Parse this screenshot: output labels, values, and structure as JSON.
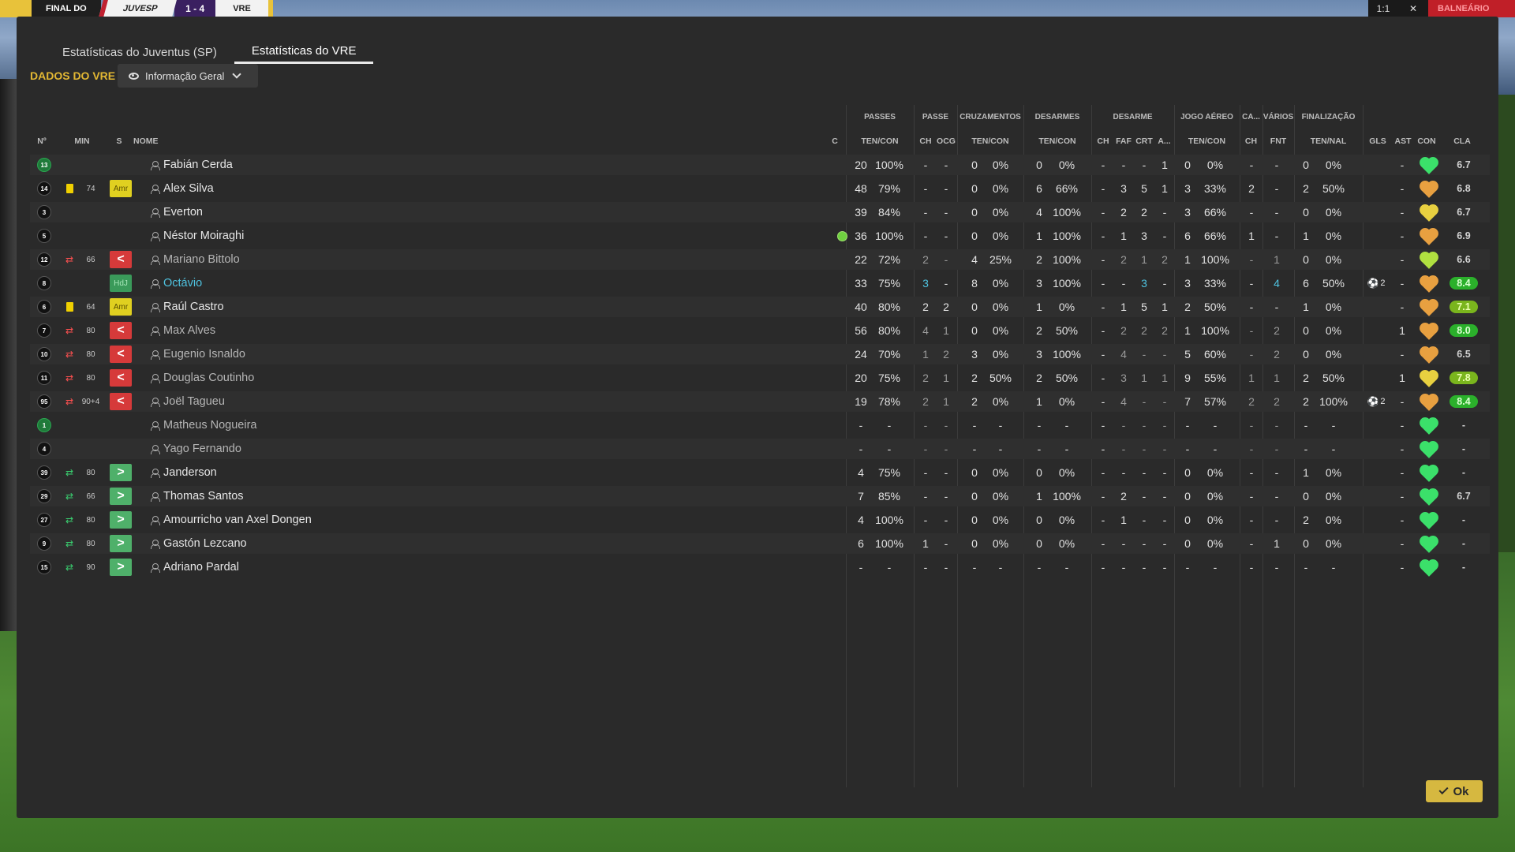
{
  "topbar": {
    "stage": "FINAL DO",
    "home": "JUVESP",
    "score": "1 - 4",
    "away": "VRE",
    "right_btn1": "1:1",
    "right_btn2": "✕",
    "right_label": "BALNEÁRIO"
  },
  "tabs": [
    {
      "label": "Estatísticas do Juventus (SP)"
    },
    {
      "label": "Estatísticas do VRE"
    }
  ],
  "section_title": "DADOS DO VRE",
  "view_select": "Informação Geral",
  "groups": {
    "passes": "PASSES",
    "passe": "PASSE",
    "cruz": "CRUZAMENTOS",
    "desarmes": "DESARMES",
    "desarme": "DESARME",
    "aereo": "JOGO AÉREO",
    "ca": "CA...",
    "varios": "VÁRIOS",
    "final": "FINALIZAÇÃO"
  },
  "headers": {
    "num": "Nº",
    "min": "MIN",
    "s": "S",
    "nome": "NOME",
    "c": "C",
    "passes_tc": "TEN/CON",
    "passe_ch": "CH",
    "passe_ocg": "OCG",
    "cruz_tc": "TEN/CON",
    "des_tc": "TEN/CON",
    "d_ch": "CH",
    "d_faf": "FAF",
    "d_crt": "CRT",
    "d_a": "A...",
    "aereo_tc": "TEN/CON",
    "ca_ch": "CH",
    "fnt": "FNT",
    "fin_tn": "TEN/NAL",
    "gls": "GLS",
    "ast": "AST",
    "con": "CON",
    "cla": "CLA"
  },
  "rows": [
    {
      "num": "13",
      "gk": true,
      "min": "",
      "card": "",
      "sub": "",
      "badge": "",
      "name": "Fabián Cerda",
      "style": "",
      "ball": false,
      "pt": "20",
      "pp": "100%",
      "pch": "-",
      "pocg": "-",
      "ct": "0",
      "cp": "0%",
      "dt": "0",
      "dp": "0%",
      "dch": "-",
      "dfaf": "-",
      "dcrt": "-",
      "da": "1",
      "at": "0",
      "ap": "0%",
      "cach": "-",
      "fnt": "-",
      "ft": "0",
      "fp": "0%",
      "gls": "",
      "ast": "-",
      "heart": "#3be06a",
      "cla": "6.7",
      "cla_style": ""
    },
    {
      "num": "14",
      "gk": false,
      "min": "74",
      "card": "y",
      "sub": "",
      "badge": "Amr",
      "name": "Alex Silva",
      "style": "",
      "ball": false,
      "pt": "48",
      "pp": "79%",
      "pch": "-",
      "pocg": "-",
      "ct": "0",
      "cp": "0%",
      "dt": "6",
      "dp": "66%",
      "dch": "-",
      "dfaf": "3",
      "dcrt": "5",
      "da": "1",
      "at": "3",
      "ap": "33%",
      "cach": "2",
      "fnt": "-",
      "ft": "2",
      "fp": "50%",
      "gls": "",
      "ast": "-",
      "heart": "#e8a040",
      "cla": "6.8",
      "cla_style": ""
    },
    {
      "num": "3",
      "gk": false,
      "min": "",
      "card": "",
      "sub": "",
      "badge": "",
      "name": "Everton",
      "style": "",
      "ball": false,
      "pt": "39",
      "pp": "84%",
      "pch": "-",
      "pocg": "-",
      "ct": "0",
      "cp": "0%",
      "dt": "4",
      "dp": "100%",
      "dch": "-",
      "dfaf": "2",
      "dcrt": "2",
      "da": "-",
      "at": "3",
      "ap": "66%",
      "cach": "-",
      "fnt": "-",
      "ft": "0",
      "fp": "0%",
      "gls": "",
      "ast": "-",
      "heart": "#e8d040",
      "cla": "6.7",
      "cla_style": ""
    },
    {
      "num": "5",
      "gk": false,
      "min": "",
      "card": "",
      "sub": "",
      "badge": "",
      "name": "Néstor Moiraghi",
      "style": "",
      "ball": true,
      "pt": "36",
      "pp": "100%",
      "pch": "-",
      "pocg": "-",
      "ct": "0",
      "cp": "0%",
      "dt": "1",
      "dp": "100%",
      "dch": "-",
      "dfaf": "1",
      "dcrt": "3",
      "da": "-",
      "at": "6",
      "ap": "66%",
      "cach": "1",
      "fnt": "-",
      "ft": "1",
      "fp": "0%",
      "gls": "",
      "ast": "-",
      "heart": "#e8a040",
      "cla": "6.9",
      "cla_style": ""
    },
    {
      "num": "12",
      "gk": false,
      "min": "66",
      "card": "",
      "sub": "out",
      "badge": "<",
      "name": "Mariano Bittolo",
      "style": "subbed",
      "ball": false,
      "pt": "22",
      "pp": "72%",
      "pch": "2",
      "pocg": "-",
      "ct": "4",
      "cp": "25%",
      "dt": "2",
      "dp": "100%",
      "dch": "-",
      "dfaf": "2",
      "dcrt": "1",
      "da": "2",
      "at": "1",
      "ap": "100%",
      "cach": "-",
      "fnt": "1",
      "ft": "0",
      "fp": "0%",
      "gls": "",
      "ast": "-",
      "heart": "#b0e040",
      "cla": "6.6",
      "cla_style": ""
    },
    {
      "num": "8",
      "gk": false,
      "min": "",
      "card": "",
      "sub": "",
      "badge": "HdJ",
      "name": "Octávio",
      "style": "hl",
      "ball": false,
      "pt": "33",
      "pp": "75%",
      "pch": "3",
      "pocg": "-",
      "ct": "8",
      "cp": "0%",
      "dt": "3",
      "dp": "100%",
      "dch": "-",
      "dfaf": "-",
      "dcrt": "3",
      "da": "-",
      "at": "3",
      "ap": "33%",
      "cach": "-",
      "fnt": "4",
      "ft": "6",
      "fp": "50%",
      "gls": "2",
      "ast": "-",
      "heart": "#e8a040",
      "cla": "8.4",
      "cla_style": "good"
    },
    {
      "num": "6",
      "gk": false,
      "min": "64",
      "card": "y",
      "sub": "",
      "badge": "Amr",
      "name": "Raúl Castro",
      "style": "",
      "ball": false,
      "pt": "40",
      "pp": "80%",
      "pch": "2",
      "pocg": "2",
      "ct": "0",
      "cp": "0%",
      "dt": "1",
      "dp": "0%",
      "dch": "-",
      "dfaf": "1",
      "dcrt": "5",
      "da": "1",
      "at": "2",
      "ap": "50%",
      "cach": "-",
      "fnt": "-",
      "ft": "1",
      "fp": "0%",
      "gls": "",
      "ast": "-",
      "heart": "#e8a040",
      "cla": "7.1",
      "cla_style": "mid"
    },
    {
      "num": "7",
      "gk": false,
      "min": "80",
      "card": "",
      "sub": "out",
      "badge": "<",
      "name": "Max Alves",
      "style": "subbed",
      "ball": false,
      "pt": "56",
      "pp": "80%",
      "pch": "4",
      "pocg": "1",
      "ct": "0",
      "cp": "0%",
      "dt": "2",
      "dp": "50%",
      "dch": "-",
      "dfaf": "2",
      "dcrt": "2",
      "da": "2",
      "at": "1",
      "ap": "100%",
      "cach": "-",
      "fnt": "2",
      "ft": "0",
      "fp": "0%",
      "gls": "",
      "ast": "1",
      "heart": "#e8a040",
      "cla": "8.0",
      "cla_style": "good"
    },
    {
      "num": "10",
      "gk": false,
      "min": "80",
      "card": "",
      "sub": "out",
      "badge": "<",
      "name": "Eugenio Isnaldo",
      "style": "subbed",
      "ball": false,
      "pt": "24",
      "pp": "70%",
      "pch": "1",
      "pocg": "2",
      "ct": "3",
      "cp": "0%",
      "dt": "3",
      "dp": "100%",
      "dch": "-",
      "dfaf": "4",
      "dcrt": "-",
      "da": "-",
      "at": "5",
      "ap": "60%",
      "cach": "-",
      "fnt": "2",
      "ft": "0",
      "fp": "0%",
      "gls": "",
      "ast": "-",
      "heart": "#e8a040",
      "cla": "6.5",
      "cla_style": ""
    },
    {
      "num": "11",
      "gk": false,
      "min": "80",
      "card": "",
      "sub": "out",
      "badge": "<",
      "name": "Douglas Coutinho",
      "style": "subbed",
      "ball": false,
      "pt": "20",
      "pp": "75%",
      "pch": "2",
      "pocg": "1",
      "ct": "2",
      "cp": "50%",
      "dt": "2",
      "dp": "50%",
      "dch": "-",
      "dfaf": "3",
      "dcrt": "1",
      "da": "1",
      "at": "9",
      "ap": "55%",
      "cach": "1",
      "fnt": "1",
      "ft": "2",
      "fp": "50%",
      "gls": "",
      "ast": "1",
      "heart": "#e8d040",
      "cla": "7.8",
      "cla_style": "mid"
    },
    {
      "num": "95",
      "gk": false,
      "min": "90+4",
      "card": "",
      "sub": "out",
      "badge": "<",
      "name": "Joël Tagueu",
      "style": "subbed",
      "ball": false,
      "pt": "19",
      "pp": "78%",
      "pch": "2",
      "pocg": "1",
      "ct": "2",
      "cp": "0%",
      "dt": "1",
      "dp": "0%",
      "dch": "-",
      "dfaf": "4",
      "dcrt": "-",
      "da": "-",
      "at": "7",
      "ap": "57%",
      "cach": "2",
      "fnt": "2",
      "ft": "2",
      "fp": "100%",
      "gls": "2",
      "ast": "-",
      "heart": "#e8a040",
      "cla": "8.4",
      "cla_style": "good"
    },
    {
      "num": "1",
      "gk": true,
      "min": "",
      "card": "",
      "sub": "",
      "badge": "",
      "name": "Matheus Nogueira",
      "style": "subbed",
      "ball": false,
      "pt": "-",
      "pp": "-",
      "pch": "-",
      "pocg": "-",
      "ct": "-",
      "cp": "-",
      "dt": "-",
      "dp": "-",
      "dch": "-",
      "dfaf": "-",
      "dcrt": "-",
      "da": "-",
      "at": "-",
      "ap": "-",
      "cach": "-",
      "fnt": "-",
      "ft": "-",
      "fp": "-",
      "gls": "",
      "ast": "-",
      "heart": "#3be06a",
      "cla": "-",
      "cla_style": ""
    },
    {
      "num": "4",
      "gk": false,
      "min": "",
      "card": "",
      "sub": "",
      "badge": "",
      "name": "Yago Fernando",
      "style": "subbed",
      "ball": false,
      "pt": "-",
      "pp": "-",
      "pch": "-",
      "pocg": "-",
      "ct": "-",
      "cp": "-",
      "dt": "-",
      "dp": "-",
      "dch": "-",
      "dfaf": "-",
      "dcrt": "-",
      "da": "-",
      "at": "-",
      "ap": "-",
      "cach": "-",
      "fnt": "-",
      "ft": "-",
      "fp": "-",
      "gls": "",
      "ast": "-",
      "heart": "#3be06a",
      "cla": "-",
      "cla_style": ""
    },
    {
      "num": "39",
      "gk": false,
      "min": "80",
      "card": "",
      "sub": "in",
      "badge": ">",
      "name": "Janderson",
      "style": "",
      "ball": false,
      "pt": "4",
      "pp": "75%",
      "pch": "-",
      "pocg": "-",
      "ct": "0",
      "cp": "0%",
      "dt": "0",
      "dp": "0%",
      "dch": "-",
      "dfaf": "-",
      "dcrt": "-",
      "da": "-",
      "at": "0",
      "ap": "0%",
      "cach": "-",
      "fnt": "-",
      "ft": "1",
      "fp": "0%",
      "gls": "",
      "ast": "-",
      "heart": "#3be06a",
      "cla": "-",
      "cla_style": ""
    },
    {
      "num": "29",
      "gk": false,
      "min": "66",
      "card": "",
      "sub": "in",
      "badge": ">",
      "name": "Thomas Santos",
      "style": "",
      "ball": false,
      "pt": "7",
      "pp": "85%",
      "pch": "-",
      "pocg": "-",
      "ct": "0",
      "cp": "0%",
      "dt": "1",
      "dp": "100%",
      "dch": "-",
      "dfaf": "2",
      "dcrt": "-",
      "da": "-",
      "at": "0",
      "ap": "0%",
      "cach": "-",
      "fnt": "-",
      "ft": "0",
      "fp": "0%",
      "gls": "",
      "ast": "-",
      "heart": "#3be06a",
      "cla": "6.7",
      "cla_style": ""
    },
    {
      "num": "27",
      "gk": false,
      "min": "80",
      "card": "",
      "sub": "in",
      "badge": ">",
      "name": "Amourricho van Axel Dongen",
      "style": "",
      "ball": false,
      "pt": "4",
      "pp": "100%",
      "pch": "-",
      "pocg": "-",
      "ct": "0",
      "cp": "0%",
      "dt": "0",
      "dp": "0%",
      "dch": "-",
      "dfaf": "1",
      "dcrt": "-",
      "da": "-",
      "at": "0",
      "ap": "0%",
      "cach": "-",
      "fnt": "-",
      "ft": "2",
      "fp": "0%",
      "gls": "",
      "ast": "-",
      "heart": "#3be06a",
      "cla": "-",
      "cla_style": ""
    },
    {
      "num": "9",
      "gk": false,
      "min": "80",
      "card": "",
      "sub": "in",
      "badge": ">",
      "name": "Gastón Lezcano",
      "style": "",
      "ball": false,
      "pt": "6",
      "pp": "100%",
      "pch": "1",
      "pocg": "-",
      "ct": "0",
      "cp": "0%",
      "dt": "0",
      "dp": "0%",
      "dch": "-",
      "dfaf": "-",
      "dcrt": "-",
      "da": "-",
      "at": "0",
      "ap": "0%",
      "cach": "-",
      "fnt": "1",
      "ft": "0",
      "fp": "0%",
      "gls": "",
      "ast": "-",
      "heart": "#3be06a",
      "cla": "-",
      "cla_style": ""
    },
    {
      "num": "15",
      "gk": false,
      "min": "90",
      "card": "",
      "sub": "in",
      "badge": ">",
      "name": "Adriano Pardal",
      "style": "",
      "ball": false,
      "pt": "-",
      "pp": "-",
      "pch": "-",
      "pocg": "-",
      "ct": "-",
      "cp": "-",
      "dt": "-",
      "dp": "-",
      "dch": "-",
      "dfaf": "-",
      "dcrt": "-",
      "da": "-",
      "at": "-",
      "ap": "-",
      "cach": "-",
      "fnt": "-",
      "ft": "-",
      "fp": "-",
      "gls": "",
      "ast": "-",
      "heart": "#3be06a",
      "cla": "-",
      "cla_style": ""
    }
  ],
  "ok_label": "Ok",
  "colors": {
    "accent_gold": "#e3b833",
    "ok_button": "#d6b840",
    "sub_out": "#d63a3a",
    "sub_in": "#4fb06a",
    "rating_good": "#2bb02b"
  }
}
